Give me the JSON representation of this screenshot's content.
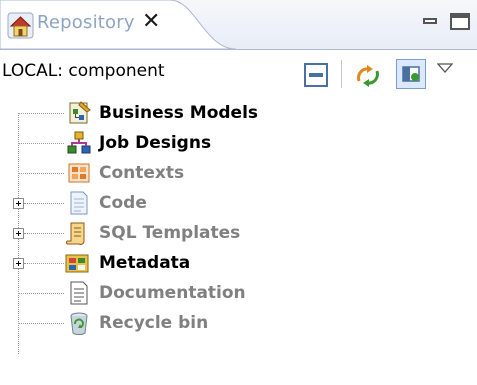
{
  "tab": {
    "title": "Repository",
    "close_glyph": "✕",
    "icon": "house-icon"
  },
  "window_controls": {
    "minimize": "minimize-icon",
    "maximize": "maximize-icon"
  },
  "toolbar": {
    "location": "LOCAL: component",
    "buttons": [
      "collapse-all-icon",
      "refresh-icon",
      "filter-icon",
      "view-menu-icon"
    ]
  },
  "tree": {
    "items": [
      {
        "label": "Business Models",
        "icon": "business-models-icon",
        "color": "#000000",
        "expandable": false
      },
      {
        "label": "Job Designs",
        "icon": "job-designs-icon",
        "color": "#000000",
        "expandable": false
      },
      {
        "label": "Contexts",
        "icon": "contexts-icon",
        "color": "#808080",
        "expandable": false
      },
      {
        "label": "Code",
        "icon": "code-icon",
        "color": "#808080",
        "expandable": true
      },
      {
        "label": "SQL Templates",
        "icon": "sql-templates-icon",
        "color": "#808080",
        "expandable": true
      },
      {
        "label": "Metadata",
        "icon": "metadata-icon",
        "color": "#000000",
        "expandable": true
      },
      {
        "label": "Documentation",
        "icon": "documentation-icon",
        "color": "#808080",
        "expandable": false
      },
      {
        "label": "Recycle bin",
        "icon": "recycle-bin-icon",
        "color": "#808080",
        "expandable": false
      }
    ]
  },
  "colors": {
    "tab_title": "#8ea4c4",
    "tab_border": "#aab8d1",
    "active_label": "#000000",
    "inactive_label": "#808080"
  }
}
